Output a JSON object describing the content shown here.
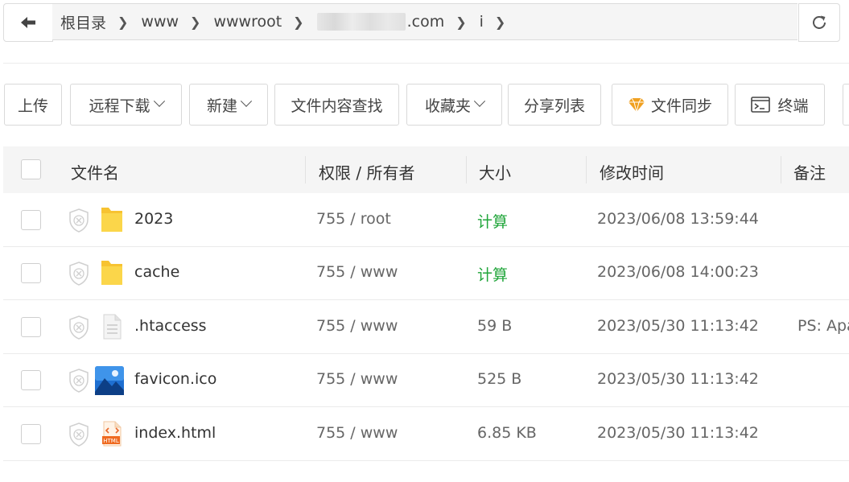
{
  "breadcrumb": {
    "items": [
      "根目录",
      "www",
      "wwwroot",
      ".com",
      "i"
    ]
  },
  "toolbar": {
    "buttons": [
      "上传",
      "远程下载",
      "新建",
      "文件内容查找",
      "收藏夹",
      "分享列表",
      "文件同步",
      "终端"
    ]
  },
  "table": {
    "headers": [
      "文件名",
      "权限 / 所有者",
      "大小",
      "修改时间",
      "备注"
    ],
    "rows": [
      {
        "name": "2023",
        "icon": "folder-icon",
        "perm": "755 / root",
        "size": "计算",
        "time": "2023/06/08 13:59:44",
        "note": ""
      },
      {
        "name": "cache",
        "icon": "folder-icon",
        "perm": "755 / www",
        "size": "计算",
        "time": "2023/06/08 14:00:23",
        "note": ""
      },
      {
        "name": ".htaccess",
        "icon": "text-file-icon",
        "perm": "755 / www",
        "size": "59 B",
        "time": "2023/05/30 11:13:42",
        "note": "PS: Apa"
      },
      {
        "name": "favicon.ico",
        "icon": "image-file-icon",
        "perm": "755 / www",
        "size": "525 B",
        "time": "2023/05/30 11:13:42",
        "note": ""
      },
      {
        "name": "index.html",
        "icon": "html-file-icon",
        "perm": "755 / www",
        "size": "6.85 KB",
        "time": "2023/05/30 11:13:42",
        "note": ""
      }
    ]
  },
  "colors": {
    "calc_link": "#20a53a",
    "folder": "#f7c331",
    "header_bg": "#f5f5f5"
  }
}
